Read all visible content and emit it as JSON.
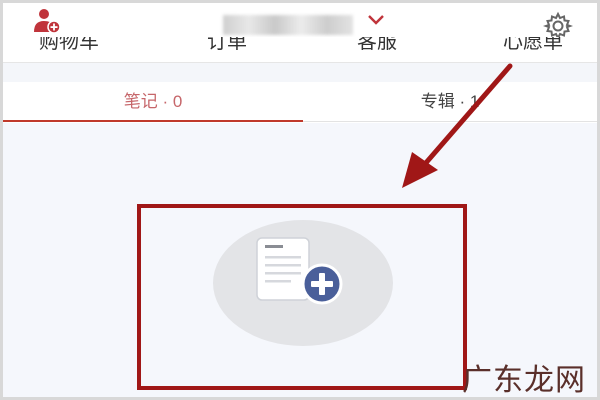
{
  "header": {
    "title": "",
    "icons": {
      "user": "add-user-icon",
      "dropdown": "chevron-down-icon",
      "settings": "gear-icon"
    }
  },
  "menu": {
    "items": [
      {
        "label": "购物车"
      },
      {
        "label": "订单"
      },
      {
        "label": "客服"
      },
      {
        "label": "心愿单"
      }
    ]
  },
  "tabs": [
    {
      "label": "笔记 · 0",
      "active": true
    },
    {
      "label": "专辑 · 1",
      "active": false
    }
  ],
  "content": {
    "empty_icon": "document-add-icon"
  },
  "watermark": "广东龙网",
  "colors": {
    "accent": "#c0392b",
    "active_tab_text": "#c6666a",
    "annotation_red": "#a01717",
    "plus_badge": "#4a5f9a"
  }
}
